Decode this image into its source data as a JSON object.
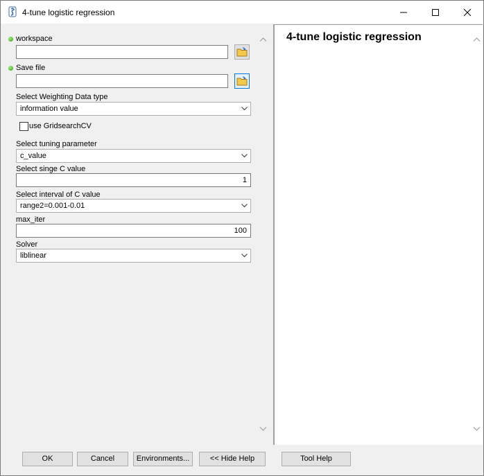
{
  "window": {
    "title": "4-tune logistic regression",
    "icon": "python-script-icon",
    "controls": [
      "minimize-icon",
      "maximize-icon",
      "close-icon"
    ]
  },
  "form": {
    "workspace": {
      "label": "workspace",
      "value": "",
      "required": true
    },
    "save_file": {
      "label": "Save file",
      "value": "",
      "required": true
    },
    "weighting_type": {
      "label": "Select Weighting Data type",
      "selected": "information value"
    },
    "gridsearch": {
      "label": "use GridsearchCV",
      "checked": false
    },
    "tuning_parameter": {
      "label": "Select tuning parameter",
      "selected": "c_value"
    },
    "single_c": {
      "label": "Select singe C value",
      "value": "1"
    },
    "c_interval": {
      "label": "Select interval of C value",
      "selected": "range2=0.001-0.01"
    },
    "max_iter": {
      "label": "max_iter",
      "value": "100"
    },
    "solver": {
      "label": "Solver",
      "selected": "liblinear"
    }
  },
  "help": {
    "title": "4-tune logistic regression"
  },
  "buttons": {
    "ok": "OK",
    "cancel": "Cancel",
    "environments": "Environments...",
    "hide_help": "<< Hide Help",
    "tool_help": "Tool Help"
  },
  "colors": {
    "required_dot": "#2e9b16",
    "focus_border": "#0078d7",
    "folder": "#f2c94c"
  }
}
